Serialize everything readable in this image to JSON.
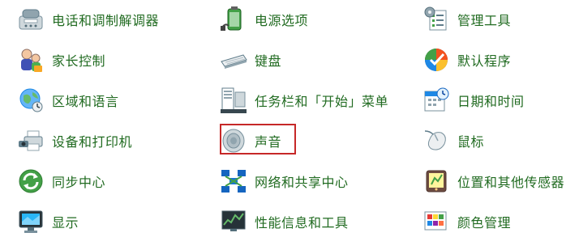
{
  "control_panel": {
    "columns": [
      {
        "items": [
          {
            "label": "电话和调制解调器",
            "icon": "phone-modem-icon"
          },
          {
            "label": "家长控制",
            "icon": "parental-controls-icon"
          },
          {
            "label": "区域和语言",
            "icon": "region-language-icon"
          },
          {
            "label": "设备和打印机",
            "icon": "devices-printers-icon"
          },
          {
            "label": "同步中心",
            "icon": "sync-center-icon"
          },
          {
            "label": "显示",
            "icon": "display-icon"
          }
        ]
      },
      {
        "items": [
          {
            "label": "电源选项",
            "icon": "power-options-icon"
          },
          {
            "label": "键盘",
            "icon": "keyboard-icon"
          },
          {
            "label": "任务栏和「开始」菜单",
            "icon": "taskbar-start-menu-icon"
          },
          {
            "label": "声音",
            "icon": "sound-icon"
          },
          {
            "label": "网络和共享中心",
            "icon": "network-sharing-icon"
          },
          {
            "label": "性能信息和工具",
            "icon": "performance-icon"
          }
        ]
      },
      {
        "items": [
          {
            "label": "管理工具",
            "icon": "admin-tools-icon"
          },
          {
            "label": "默认程序",
            "icon": "default-programs-icon"
          },
          {
            "label": "日期和时间",
            "icon": "date-time-icon"
          },
          {
            "label": "鼠标",
            "icon": "mouse-icon"
          },
          {
            "label": "位置和其他传感器",
            "icon": "location-sensors-icon"
          },
          {
            "label": "颜色管理",
            "icon": "color-management-icon"
          }
        ]
      }
    ],
    "highlighted_item": "声音",
    "colors": {
      "label_text": "#216b21",
      "highlight_border": "#c62828",
      "background": "#ffffff"
    }
  }
}
